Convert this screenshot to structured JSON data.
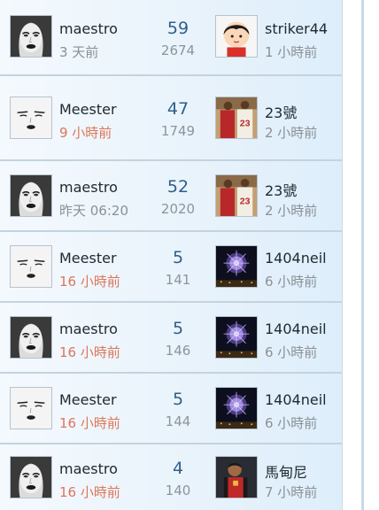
{
  "threads": [
    {
      "author": {
        "name": "maestro",
        "time": "3 天前",
        "avatar": "woman-face-icon",
        "recent": false
      },
      "replies": "59",
      "views": "2674",
      "last_poster": {
        "name": "striker44",
        "time": "1 小時前",
        "avatar": "cartoon-boy-icon",
        "recent": false
      }
    },
    {
      "author": {
        "name": "Meester",
        "time": "9 小時前",
        "avatar": "face-sketch-icon",
        "recent": true
      },
      "replies": "47",
      "views": "1749",
      "last_poster": {
        "name": "23號",
        "time": "2 小時前",
        "avatar": "basketball-players-icon",
        "recent": false
      }
    },
    {
      "author": {
        "name": "maestro",
        "time": "昨天 06:20",
        "avatar": "woman-face-icon",
        "recent": false
      },
      "replies": "52",
      "views": "2020",
      "last_poster": {
        "name": "23號",
        "time": "2 小時前",
        "avatar": "basketball-players-icon",
        "recent": false
      }
    },
    {
      "author": {
        "name": "Meester",
        "time": "16 小時前",
        "avatar": "face-sketch-icon",
        "recent": true
      },
      "replies": "5",
      "views": "141",
      "last_poster": {
        "name": "1404neil",
        "time": "6 小時前",
        "avatar": "fireworks-icon",
        "recent": false
      }
    },
    {
      "author": {
        "name": "maestro",
        "time": "16 小時前",
        "avatar": "woman-face-icon",
        "recent": true
      },
      "replies": "5",
      "views": "146",
      "last_poster": {
        "name": "1404neil",
        "time": "6 小時前",
        "avatar": "fireworks-icon",
        "recent": false
      }
    },
    {
      "author": {
        "name": "Meester",
        "time": "16 小時前",
        "avatar": "face-sketch-icon",
        "recent": true
      },
      "replies": "5",
      "views": "144",
      "last_poster": {
        "name": "1404neil",
        "time": "6 小時前",
        "avatar": "fireworks-icon",
        "recent": false
      }
    },
    {
      "author": {
        "name": "maestro",
        "time": "16 小時前",
        "avatar": "woman-face-icon",
        "recent": true
      },
      "replies": "4",
      "views": "140",
      "last_poster": {
        "name": "馬甸尼",
        "time": "7 小時前",
        "avatar": "football-player-icon",
        "recent": false
      }
    }
  ],
  "colors": {
    "recent_time": "#de7559",
    "old_time": "#8a9096",
    "reply_count": "#2f5f8a",
    "separator": "#c3d3df"
  }
}
